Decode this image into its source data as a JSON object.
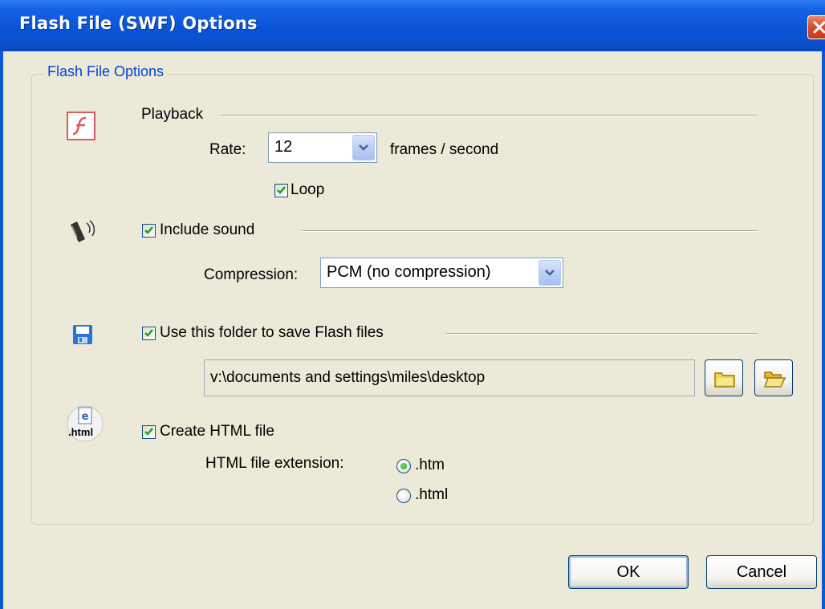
{
  "window": {
    "title": "Flash File (SWF) Options",
    "accent": "#0a5ad8"
  },
  "group": {
    "title": "Flash File Options"
  },
  "playback": {
    "heading": "Playback",
    "icon": "flash-icon",
    "rate_label": "Rate:",
    "rate_value": "12",
    "rate_unit": "frames / second",
    "loop_label": "Loop",
    "loop_checked": true
  },
  "sound": {
    "icon": "speaker-icon",
    "include_label": "Include sound",
    "include_checked": true,
    "compression_label": "Compression:",
    "compression_value": "PCM  (no compression)"
  },
  "folder": {
    "icon": "floppy-disk-icon",
    "use_label": "Use this folder to save Flash files",
    "use_checked": true,
    "path": "v:\\documents and settings\\miles\\desktop"
  },
  "html": {
    "icon": "html-file-icon",
    "icon_text": ".html",
    "create_label": "Create HTML file",
    "create_checked": true,
    "extension_label": "HTML file extension:",
    "options": [
      ".htm",
      ".html"
    ],
    "selected": ".htm"
  },
  "buttons": {
    "ok": "OK",
    "cancel": "Cancel"
  }
}
